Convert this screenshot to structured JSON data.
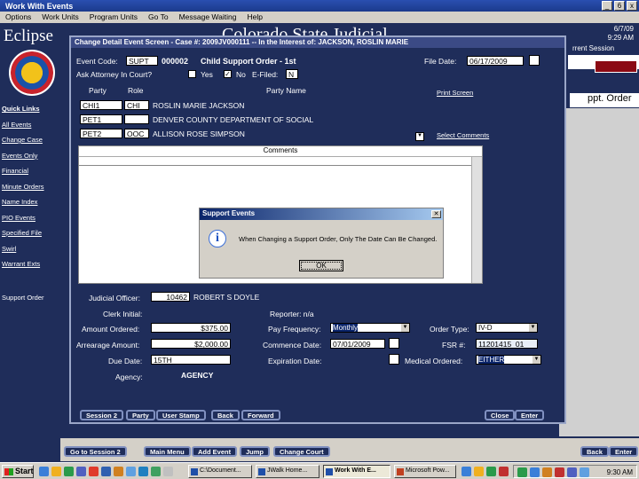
{
  "window": {
    "title": "Work With Events",
    "controls": [
      "_",
      "6",
      "x"
    ]
  },
  "menu": [
    "Options",
    "Work Units",
    "Program Units",
    "Go To",
    "Message Waiting",
    "Help"
  ],
  "app": {
    "brand": "Eclipse",
    "banner": "Colorado State Judicial",
    "date": "6/7/09",
    "time": "9:29 AM",
    "session_label": "rrent Session",
    "support_order_label": "ppt. Order"
  },
  "leftnav": [
    "Quick Links",
    "All Events",
    "Change Case",
    "Events Only",
    "Financial",
    "Minute Orders",
    "Name Index",
    "PIO Events",
    "Specified File",
    "Swirl",
    "Warrant Exts",
    "Support Order"
  ],
  "bottom_buttons": [
    "Go to Session 2",
    "Main Menu",
    "Add Event",
    "Jump",
    "Change Court",
    "Back",
    "Enter"
  ],
  "dialog": {
    "title": "Change Detail Event Screen - Case #: 2009JV000111 -- In the Interest of: JACKSON, ROSLIN MARIE",
    "event_code_label": "Event Code:",
    "event_code": "SUPT",
    "event_seq": "000002",
    "event_desc": "Child Support Order - 1st",
    "file_date_label": "File Date:",
    "file_date": "06/17/2009",
    "atty_label": "Ask Attorney In Court?",
    "yes_label": "Yes",
    "no_label": "No",
    "efiled_label": "E-Filed:",
    "efiled_value": "N",
    "party_headers": [
      "Party",
      "Role",
      "Party Name"
    ],
    "parties": [
      {
        "party": "CHI1",
        "role": "CHI",
        "name": "ROSLIN MARIE JACKSON"
      },
      {
        "party": "PET1",
        "role": "",
        "name": "DENVER COUNTY DEPARTMENT OF SOCIAL"
      },
      {
        "party": "PET2",
        "role": "OOC",
        "name": "ALLISON ROSE SIMPSON"
      }
    ],
    "print_screen": "Print Screen",
    "select_comments": "Select Comments",
    "comments_header": "Comments",
    "judicial_officer_label": "Judicial Officer:",
    "judicial_officer_code": "10462",
    "judicial_officer_name": "ROBERT S DOYLE",
    "clerk_initial_label": "Clerk Initial:",
    "reporter_label": "Reporter: n/a",
    "amount_ordered_label": "Amount Ordered:",
    "amount_ordered": "$375.00",
    "pay_frequency_label": "Pay Frequency:",
    "pay_frequency": "Monthly",
    "order_type_label": "Order Type:",
    "order_type": "IV-D",
    "arrearage_label": "Arrearage Amount:",
    "arrearage": "$2,000.00",
    "commence_label": "Commence Date:",
    "commence_date": "07/01/2009",
    "fsr_label": "FSR #:",
    "fsr_value": "11201415_01",
    "due_date_label": "Due Date:",
    "due_date": "15TH",
    "expiration_label": "Expiration Date:",
    "medical_label": "Medical Ordered:",
    "medical_value": "EITHER",
    "agency_label": "Agency:",
    "agency_value": "AGENCY",
    "buttons": [
      "Session 2",
      "Party",
      "User Stamp",
      "Back",
      "Forward",
      "Close",
      "Enter"
    ]
  },
  "message_box": {
    "title": "Support Events",
    "text": "When Changing a Support Order, Only The Date Can Be Changed.",
    "ok": "OK"
  },
  "taskbar": {
    "start": "Start",
    "items": [
      "C:\\Document...",
      "JWalk Home...",
      "Work With E...",
      "Microsoft Pow..."
    ],
    "clock": "9:30 AM"
  }
}
